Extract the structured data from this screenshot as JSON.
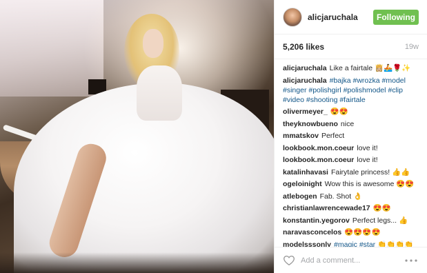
{
  "header": {
    "username": "alicjaruchala",
    "follow_label": "Following",
    "avatar_icon": "profile-avatar"
  },
  "stats": {
    "likes": "5,206 likes",
    "age": "19w"
  },
  "comments": [
    {
      "user": "alicjaruchala",
      "text": "Like a fairtale 👸🏼🚣🌹✨"
    },
    {
      "user": "alicjaruchala",
      "tags": [
        "#bajka",
        "#wrozka",
        "#model",
        "#singer",
        "#polishgirl",
        "#polishmodel",
        "#clip",
        "#video",
        "#shooting",
        "#fairtale"
      ]
    },
    {
      "user": "olivermeyer_",
      "text": "😍😍"
    },
    {
      "user": "theyknowbueno",
      "text": "nice"
    },
    {
      "user": "mmatskov",
      "text": "Perfect"
    },
    {
      "user": "lookbook.mon.coeur",
      "text": "love it!"
    },
    {
      "user": "lookbook.mon.coeur",
      "text": "love it!"
    },
    {
      "user": "katalinhavasi",
      "text": "Fairytale princess! 👍👍"
    },
    {
      "user": "ogeloinight",
      "text": "Wow this is awesome 😍😍"
    },
    {
      "user": "atlebogen",
      "text": "Fab. Shot 👌"
    },
    {
      "user": "christianlawrencewade17",
      "text": "😍😍"
    },
    {
      "user": "konstantin.yegorov",
      "text": "Perfect legs... 👍"
    },
    {
      "user": "naravasconcelos",
      "text": "😍😍😍😍"
    },
    {
      "user": "modelsssonly",
      "tags": [
        "#magic",
        "#star"
      ],
      "text": "👏👏👏👏"
    }
  ],
  "footer": {
    "comment_placeholder": "Add a comment...",
    "heart_icon": "heart-outline",
    "more_icon": "ellipsis"
  },
  "colors": {
    "follow_button": "#70c050",
    "hashtag": "#125688",
    "muted": "#a5a7aa"
  }
}
